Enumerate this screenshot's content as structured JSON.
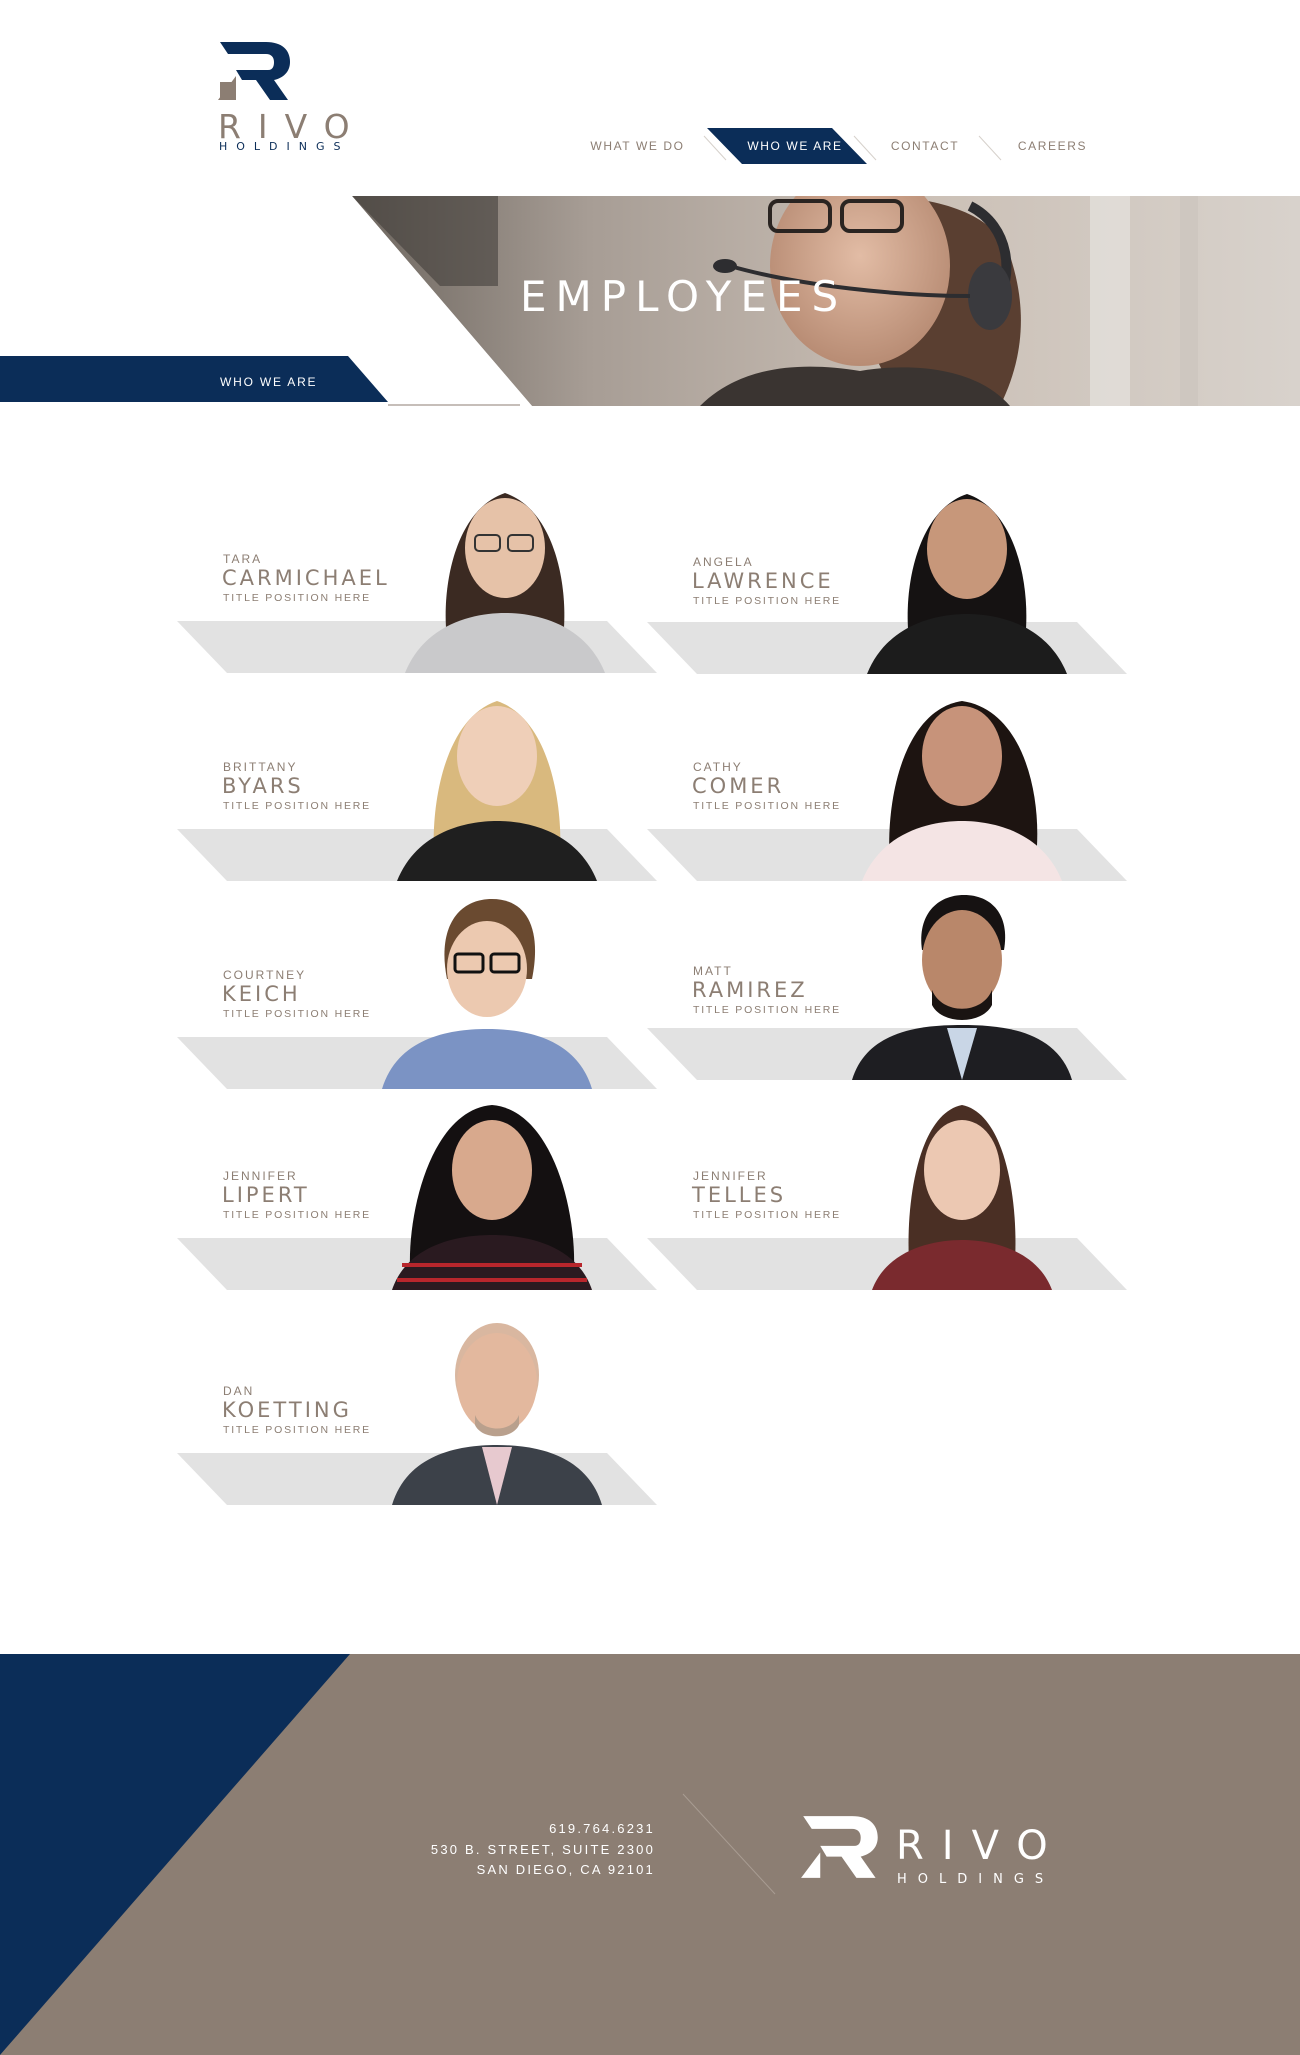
{
  "brand": {
    "name": "RIVO",
    "sub": "HOLDINGS",
    "colors": {
      "navy": "#0b2d58",
      "taupe": "#8c7e73",
      "gray_band": "#e2e2e2"
    }
  },
  "nav": {
    "items": [
      {
        "label": "WHAT WE DO"
      },
      {
        "label": "WHO WE ARE",
        "active": true
      },
      {
        "label": "CONTACT"
      },
      {
        "label": "CAREERS"
      }
    ]
  },
  "hero": {
    "title": "EMPLOYEES",
    "badge": "WHO WE ARE"
  },
  "employees": [
    {
      "first": "TARA",
      "last": "CARMICHAEL",
      "title": "TITLE POSITION HERE",
      "hair": "#3b2a22",
      "skin": "#e6c2a8",
      "shirt": "#c9c9cb"
    },
    {
      "first": "ANGELA",
      "last": "LAWRENCE",
      "title": "TITLE POSITION HERE",
      "hair": "#151212",
      "skin": "#c7977a",
      "shirt": "#1c1c1c"
    },
    {
      "first": "BRITTANY",
      "last": "BYARS",
      "title": "TITLE POSITION HERE",
      "hair": "#d9b97e",
      "skin": "#efcfb8",
      "shirt": "#1f1f1f"
    },
    {
      "first": "CATHY",
      "last": "COMER",
      "title": "TITLE POSITION HERE",
      "hair": "#1d1411",
      "skin": "#c7937a",
      "shirt": "#f4e4e4"
    },
    {
      "first": "COURTNEY",
      "last": "KEICH",
      "title": "TITLE POSITION HERE",
      "hair": "#6a4a30",
      "skin": "#ecc9b0",
      "shirt": "#7b93c4"
    },
    {
      "first": "MATT",
      "last": "RAMIREZ",
      "title": "TITLE POSITION HERE",
      "hair": "#161212",
      "skin": "#b9876a",
      "shirt": "#1e1e22"
    },
    {
      "first": "JENNIFER",
      "last": "LIPERT",
      "title": "TITLE POSITION HERE",
      "hair": "#141011",
      "skin": "#d8a98d",
      "shirt": "#2a1a20"
    },
    {
      "first": "JENNIFER",
      "last": "TELLES",
      "title": "TITLE POSITION HERE",
      "hair": "#4a2f24",
      "skin": "#ecc8b2",
      "shirt": "#7a2a2e"
    },
    {
      "first": "DAN",
      "last": "KOETTING",
      "title": "TITLE POSITION HERE",
      "hair": "#d9b7a0",
      "skin": "#e3b89e",
      "shirt": "#3c4149"
    }
  ],
  "footer": {
    "phone": "619.764.6231",
    "address1": "530 B. STREET, SUITE 2300",
    "address2": "SAN DIEGO, CA 92101",
    "logo_name": "RIVO",
    "logo_sub": "HOLDINGS"
  }
}
